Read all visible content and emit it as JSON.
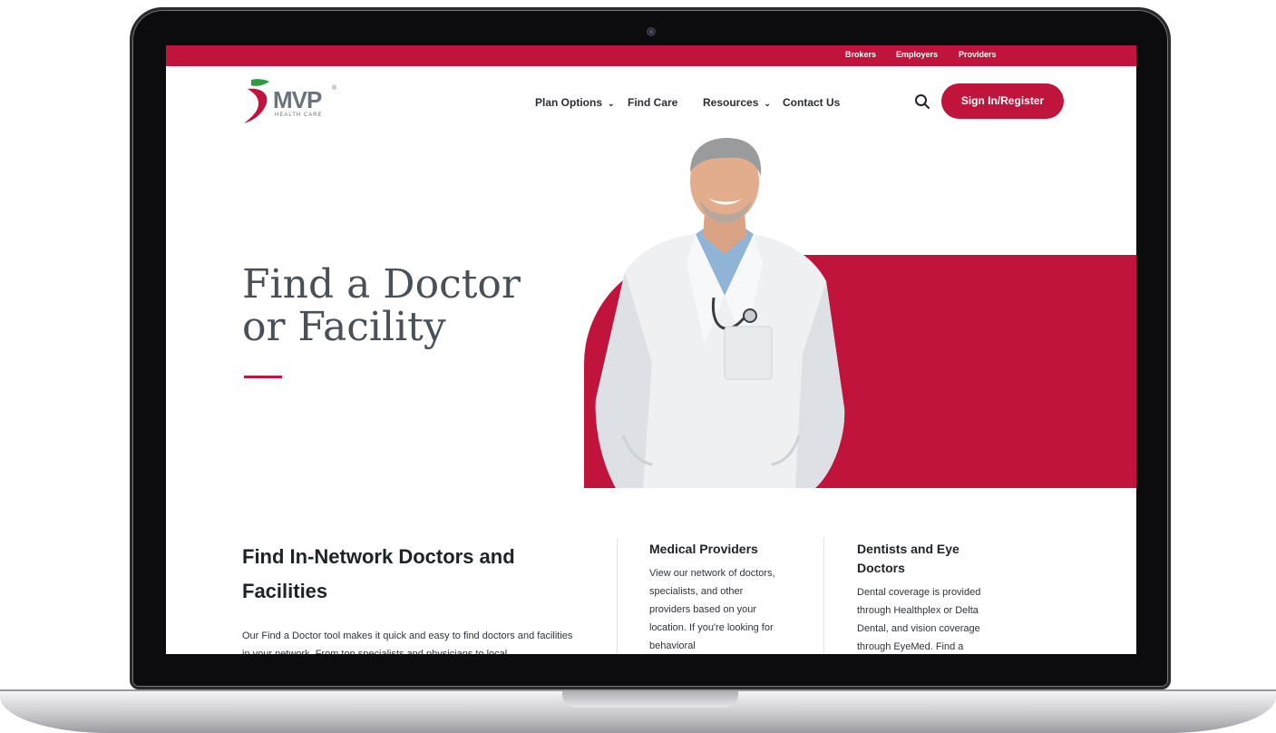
{
  "utility_nav": [
    "Brokers",
    "Employers",
    "Providers"
  ],
  "brand": {
    "name": "MVP",
    "tagline": "HEALTH CARE",
    "registered": "®"
  },
  "main_nav": {
    "plan_options": "Plan Options",
    "find_care": "Find Care",
    "resources": "Resources",
    "contact_us": "Contact Us",
    "sign_in": "Sign In/Register"
  },
  "hero": {
    "title_line1": "Find a Doctor",
    "title_line2": "or Facility"
  },
  "section": {
    "title": "Find In-Network Doctors and Facilities",
    "body": "Our Find a Doctor tool makes it quick and easy to find doctors and facilities in your network. From top specialists and physicians to local"
  },
  "columns": [
    {
      "title": "Medical Providers",
      "body": "View our network of doctors, specialists, and other providers based on your location. If you're looking for behavioral"
    },
    {
      "title": "Dentists and Eye Doctors",
      "body": "Dental coverage is provided through Healthplex or Delta Dental, and vision coverage through EyeMed. Find a"
    }
  ],
  "colors": {
    "brand_red": "#c0143c",
    "text_dark": "#1e2328",
    "heading_gray": "#4a5058"
  },
  "icons": [
    "search-icon",
    "chevron-down-icon",
    "logo-leaf-icon",
    "camera-icon"
  ]
}
